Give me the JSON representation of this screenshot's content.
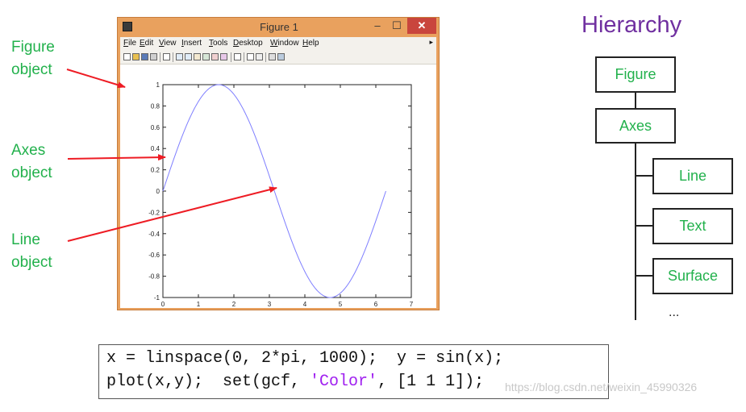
{
  "labels": {
    "figure": [
      "Figure",
      "object"
    ],
    "axes": [
      "Axes",
      "object"
    ],
    "line": [
      "Line",
      "object"
    ]
  },
  "window": {
    "title": "Figure 1",
    "buttons": {
      "minimize": "–",
      "maximize": "☐",
      "close": "✕"
    },
    "menu": [
      "File",
      "Edit",
      "View",
      "Insert",
      "Tools",
      "Desktop",
      "Window",
      "Help"
    ],
    "menu_extra": "▸"
  },
  "chart_data": {
    "type": "line",
    "title": "",
    "xlabel": "",
    "ylabel": "",
    "xlim": [
      0,
      7
    ],
    "ylim": [
      -1,
      1
    ],
    "x_ticks": [
      "0",
      "1",
      "2",
      "3",
      "4",
      "5",
      "6",
      "7"
    ],
    "y_ticks": [
      "1",
      "0.8",
      "0.6",
      "0.4",
      "0.2",
      "0",
      "-0.2",
      "-0.4",
      "-0.6",
      "-0.8",
      "-1"
    ],
    "series": [
      {
        "function": "y = sin(x)",
        "x_range": [
          0,
          6.2832
        ],
        "points": 1000,
        "color": "#7f7fff"
      }
    ],
    "grid": false
  },
  "hierarchy": {
    "title": "Hierarchy",
    "root": "Figure",
    "child": "Axes",
    "leaves": [
      "Line",
      "Text",
      "Surface"
    ],
    "more": "..."
  },
  "code": {
    "line1": "x = linspace(0, 2*pi, 1000);  y = sin(x);",
    "line2_pre": "plot(x,y);  set(gcf, ",
    "line2_str": "'Color'",
    "line2_post": ", [1 1 1]);"
  },
  "watermark": "https://blog.csdn.net/weixin_45990326",
  "colors": {
    "label_green": "#22b14c",
    "hierarchy_purple": "#7030a0",
    "arrow_red": "#ee1c24",
    "window_frame": "#e9a15e",
    "code_string": "#a020f0"
  }
}
